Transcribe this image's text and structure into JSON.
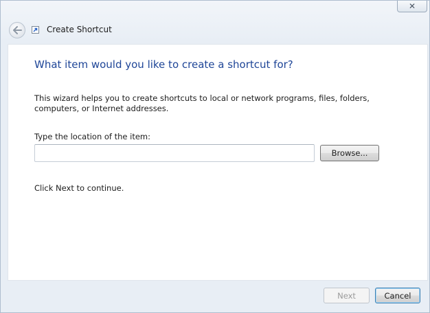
{
  "window": {
    "title": "Create Shortcut",
    "close_label": "✕"
  },
  "wizard": {
    "heading": "What item would you like to create a shortcut for?",
    "description": "This wizard helps you to create shortcuts to local or network programs, files, folders, computers, or Internet addresses.",
    "location_label": "Type the location of the item:",
    "location_value": "",
    "browse_label": "Browse...",
    "continue_text": "Click Next to continue."
  },
  "footer": {
    "next_label": "Next",
    "cancel_label": "Cancel"
  },
  "colors": {
    "heading": "#1e4597",
    "accent_border": "#3c7fb1",
    "disabled_text": "#9a9a9a"
  },
  "icons": {
    "back": "back-arrow-icon",
    "app": "shortcut-arrow-icon",
    "close": "close-icon"
  }
}
